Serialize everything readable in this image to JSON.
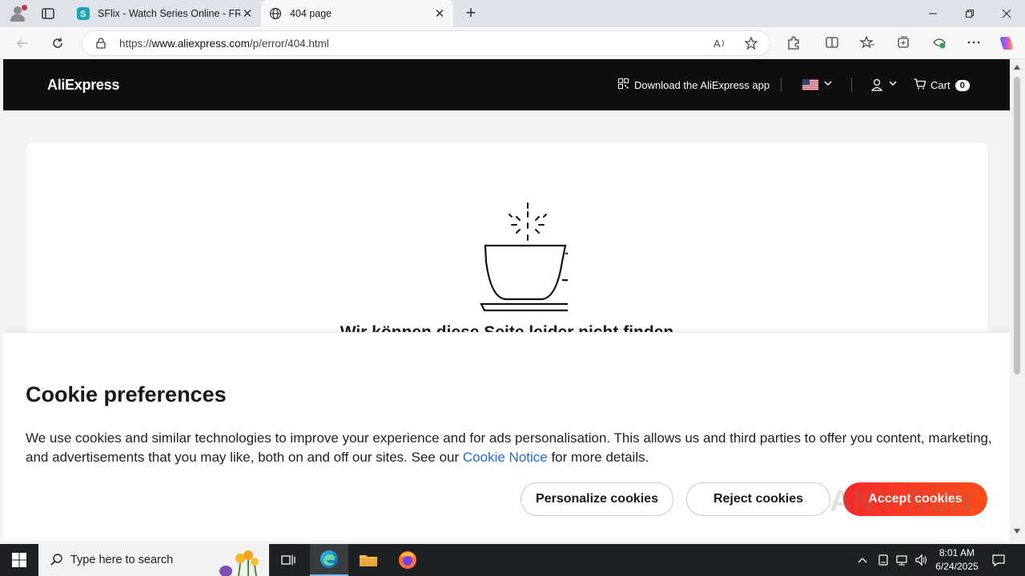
{
  "browser": {
    "tabs": [
      {
        "title": "SFlix - Watch Series Online - FREE",
        "close": "✕"
      },
      {
        "title": "404 page",
        "close": "✕"
      }
    ],
    "new_tab": "+",
    "url_prefix": "https://",
    "url_host": "www.aliexpress.com",
    "url_path": "/p/error/404.html"
  },
  "header": {
    "logo": "AliExpress",
    "download_app": "Download the AliExpress app",
    "cart_label": "Cart",
    "cart_count": "0"
  },
  "error": {
    "title": "Wir können diese Seite leider nicht finden"
  },
  "cookie": {
    "title": "Cookie preferences",
    "text_before": "We use cookies and similar technologies to improve your experience and for ads personalisation. This allows us and third parties to offer you content, marketing, and advertisements that you may like, both on and off our sites. See our ",
    "link": "Cookie Notice",
    "text_after": " for more details.",
    "personalize": "Personalize cookies",
    "reject": "Reject cookies",
    "accept": "Accept cookies"
  },
  "watermark": "ANY RUN",
  "taskbar": {
    "search_placeholder": "Type here to search",
    "time": "8:01 AM",
    "date": "6/24/2025"
  },
  "colors": {
    "accent": "#fd3c1c",
    "link": "#1a6fd8",
    "header_bg": "#0f0f0f"
  }
}
